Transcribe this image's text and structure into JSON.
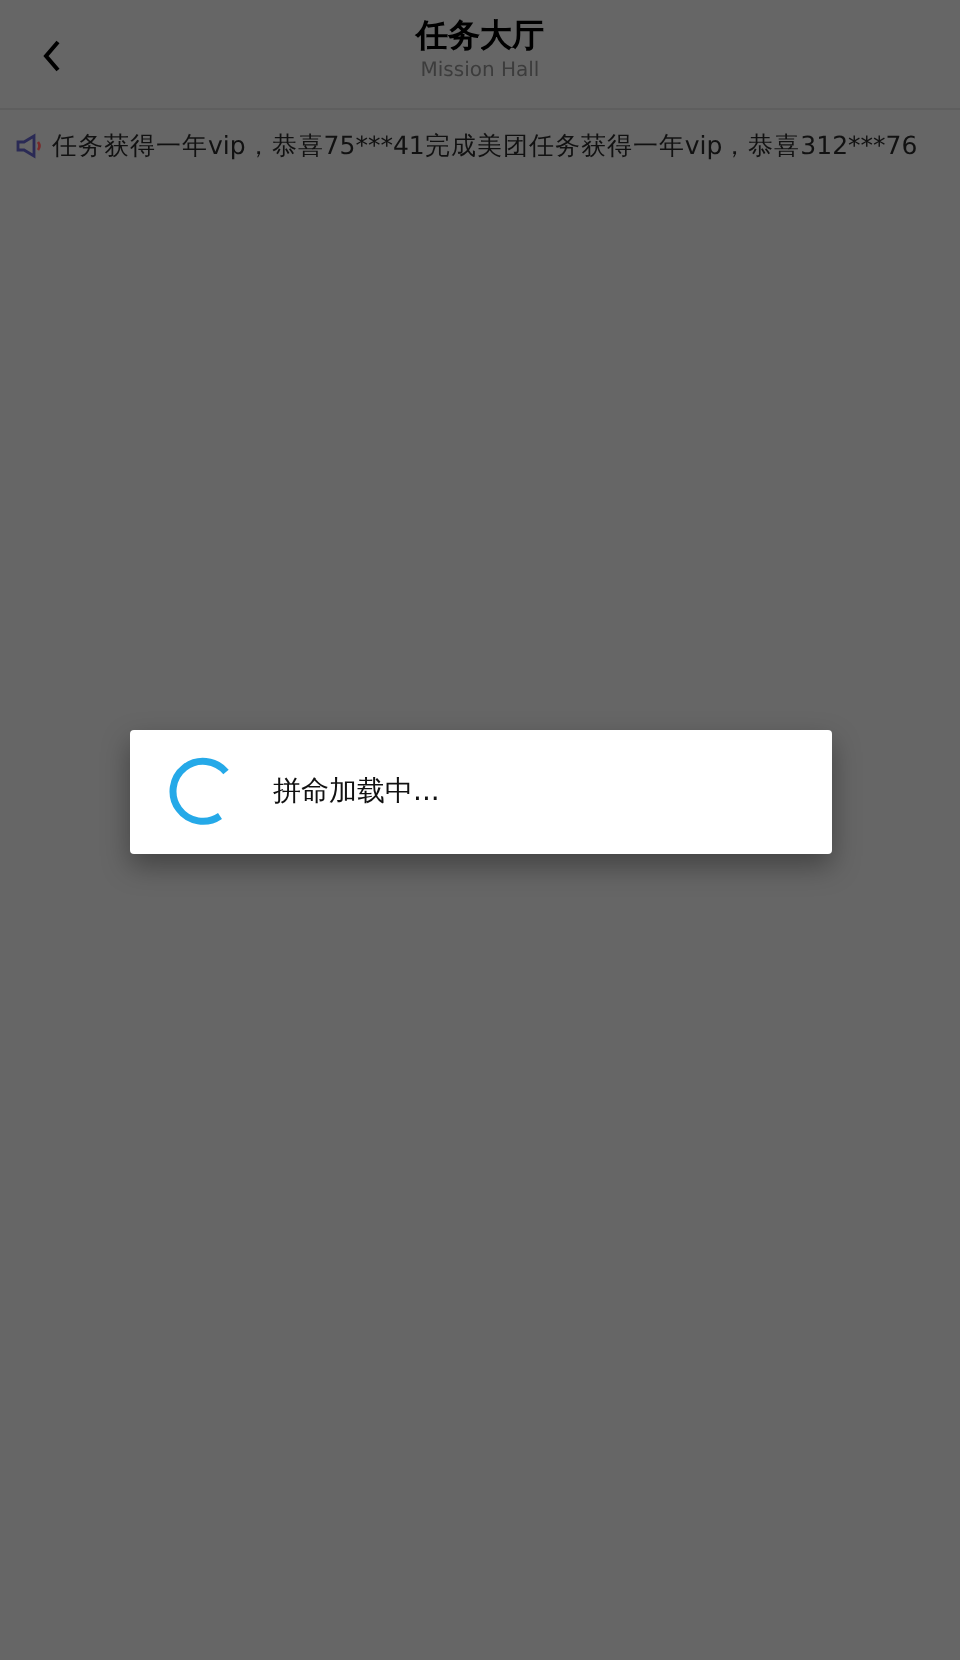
{
  "header": {
    "title": "任务大厅",
    "subtitle": "Mission Hall"
  },
  "notice": {
    "text": "任务获得一年vip，恭喜75***41完成美团任务获得一年vip，恭喜312***76"
  },
  "loading_dialog": {
    "message": "拼命加载中..."
  }
}
